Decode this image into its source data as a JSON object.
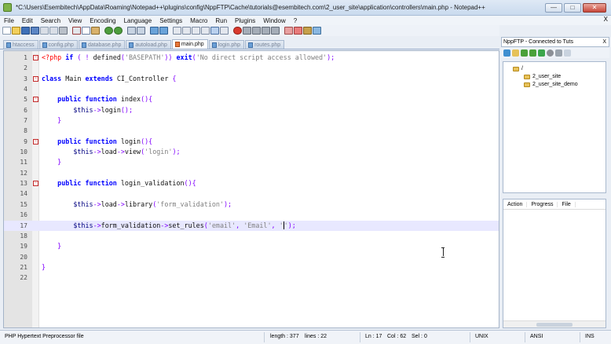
{
  "window": {
    "title": "*C:\\Users\\Esembitech\\AppData\\Roaming\\Notepad++\\plugins\\config\\NppFTP\\Cache\\tutorials@esembitech.com\\2_user_site\\application\\controllers\\main.php - Notepad++",
    "buttons": {
      "minimize": "—",
      "maximize": "□",
      "close": "✕"
    }
  },
  "menu": {
    "items": [
      "File",
      "Edit",
      "Search",
      "View",
      "Encoding",
      "Language",
      "Settings",
      "Macro",
      "Run",
      "Plugins",
      "Window",
      "?"
    ],
    "close_label": "X"
  },
  "tabs": [
    {
      "label": "htaccess",
      "active": false
    },
    {
      "label": "config.php",
      "active": false
    },
    {
      "label": "database.php",
      "active": false
    },
    {
      "label": "autoload.php",
      "active": false
    },
    {
      "label": "main.php",
      "active": true
    },
    {
      "label": "login.php",
      "active": false
    },
    {
      "label": "routes.php",
      "active": false
    }
  ],
  "editor": {
    "lines": [
      {
        "n": "1",
        "fold": "minus",
        "html": "<span class=\"php\">&lt;?php</span> <span class=\"kw\">if</span> <span class=\"op\">( !</span> defined<span class=\"op\">(</span><span class=\"str\">'BASEPATH'</span><span class=\"op\">))</span> <span class=\"kw\">exit</span><span class=\"op\">(</span><span class=\"str\">'No direct script access allowed'</span><span class=\"op\">);</span>"
      },
      {
        "n": "2",
        "fold": "",
        "html": ""
      },
      {
        "n": "3",
        "fold": "minus",
        "html": "<span class=\"kw\">class</span> Main <span class=\"kw\">extends</span> CI_Controller <span class=\"op\">{</span>"
      },
      {
        "n": "4",
        "fold": "",
        "html": ""
      },
      {
        "n": "5",
        "fold": "minus",
        "html": "    <span class=\"kw\">public</span> <span class=\"kw\">function</span> index<span class=\"op\">(){</span>"
      },
      {
        "n": "6",
        "fold": "",
        "html": "        <span class=\"var\">$this</span><span class=\"op\">-&gt;</span>login<span class=\"op\">();</span>"
      },
      {
        "n": "7",
        "fold": "",
        "html": "    <span class=\"op\">}</span>"
      },
      {
        "n": "8",
        "fold": "",
        "html": ""
      },
      {
        "n": "9",
        "fold": "minus",
        "html": "    <span class=\"kw\">public</span> <span class=\"kw\">function</span> login<span class=\"op\">(){</span>"
      },
      {
        "n": "10",
        "fold": "",
        "html": "        <span class=\"var\">$this</span><span class=\"op\">-&gt;</span>load<span class=\"op\">-&gt;</span>view<span class=\"op\">(</span><span class=\"str\">'login'</span><span class=\"op\">);</span>"
      },
      {
        "n": "11",
        "fold": "",
        "html": "    <span class=\"op\">}</span>"
      },
      {
        "n": "12",
        "fold": "",
        "html": ""
      },
      {
        "n": "13",
        "fold": "minus",
        "html": "    <span class=\"kw\">public</span> <span class=\"kw\">function</span> login_validation<span class=\"op\">(){</span>"
      },
      {
        "n": "14",
        "fold": "",
        "html": ""
      },
      {
        "n": "15",
        "fold": "",
        "html": "        <span class=\"var\">$this</span><span class=\"op\">-&gt;</span>load<span class=\"op\">-&gt;</span>library<span class=\"op\">(</span><span class=\"str\">'form_validation'</span><span class=\"op\">);</span>"
      },
      {
        "n": "16",
        "fold": "",
        "html": ""
      },
      {
        "n": "17",
        "fold": "",
        "current": true,
        "html": "        <span class=\"var\">$this</span><span class=\"op\">-&gt;</span>form_validation<span class=\"op\">-&gt;</span>set_rules<span class=\"op\">(</span><span class=\"str\">'email'</span><span class=\"op\">,</span> <span class=\"str\">'Email'</span><span class=\"op\">,</span> <span class=\"str\">'<span class=\"caret\"></span>'</span><span class=\"op\">);</span>"
      },
      {
        "n": "18",
        "fold": "",
        "html": ""
      },
      {
        "n": "19",
        "fold": "",
        "html": "    <span class=\"op\">}</span>"
      },
      {
        "n": "20",
        "fold": "",
        "html": ""
      },
      {
        "n": "21",
        "fold": "",
        "html": "<span class=\"op\">}</span>"
      },
      {
        "n": "22",
        "fold": "",
        "html": ""
      }
    ]
  },
  "nppftp": {
    "title": "NppFTP - Connected to Tuts",
    "close": "X",
    "tree": [
      {
        "label": "/",
        "depth": 0
      },
      {
        "label": "2_user_site",
        "depth": 1
      },
      {
        "label": "2_user_site_demo",
        "depth": 1
      }
    ],
    "transfer_headers": [
      "Action",
      "Progress",
      "File"
    ]
  },
  "status": {
    "file_type": "PHP Hypertext Preprocessor file",
    "length": "length : 377",
    "lines": "lines : 22",
    "ln": "Ln : 17",
    "col": "Col : 62",
    "sel": "Sel : 0",
    "eol": "UNIX",
    "encoding": "ANSI",
    "mode": "INS"
  },
  "colors": {
    "keyword": "#0000ff",
    "php_tag": "#ff0000",
    "string": "#808080",
    "operator": "#8000ff",
    "current_line": "#e8e8ff"
  }
}
